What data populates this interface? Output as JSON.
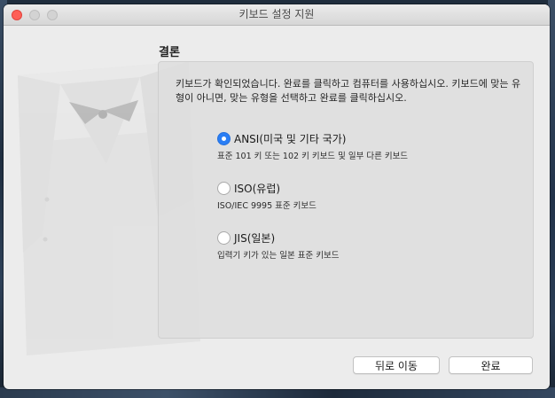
{
  "window": {
    "title": "키보드 설정 지원"
  },
  "section": {
    "heading": "결론"
  },
  "panel": {
    "description": "키보드가 확인되었습니다. 완료를 클릭하고 컴퓨터를 사용하십시오. 키보드에 맞는 유형이 아니면, 맞는 유형을 선택하고 완료를 클릭하십시오."
  },
  "options": [
    {
      "label": "ANSI(미국 및 기타 국가)",
      "description": "표준 101 키 또는 102 키 키보드 및 일부 다른 키보드",
      "selected": true
    },
    {
      "label": "ISO(유럽)",
      "description": "ISO/IEC 9995 표준 키보드",
      "selected": false
    },
    {
      "label": "JIS(일본)",
      "description": "입력기 키가 있는 일본 표준 키보드",
      "selected": false
    }
  ],
  "buttons": {
    "back_label": "뒤로 이동",
    "done_label": "완료"
  },
  "colors": {
    "accent": "#2a7ef5",
    "close": "#fe5f57",
    "window_bg": "#ececec"
  }
}
